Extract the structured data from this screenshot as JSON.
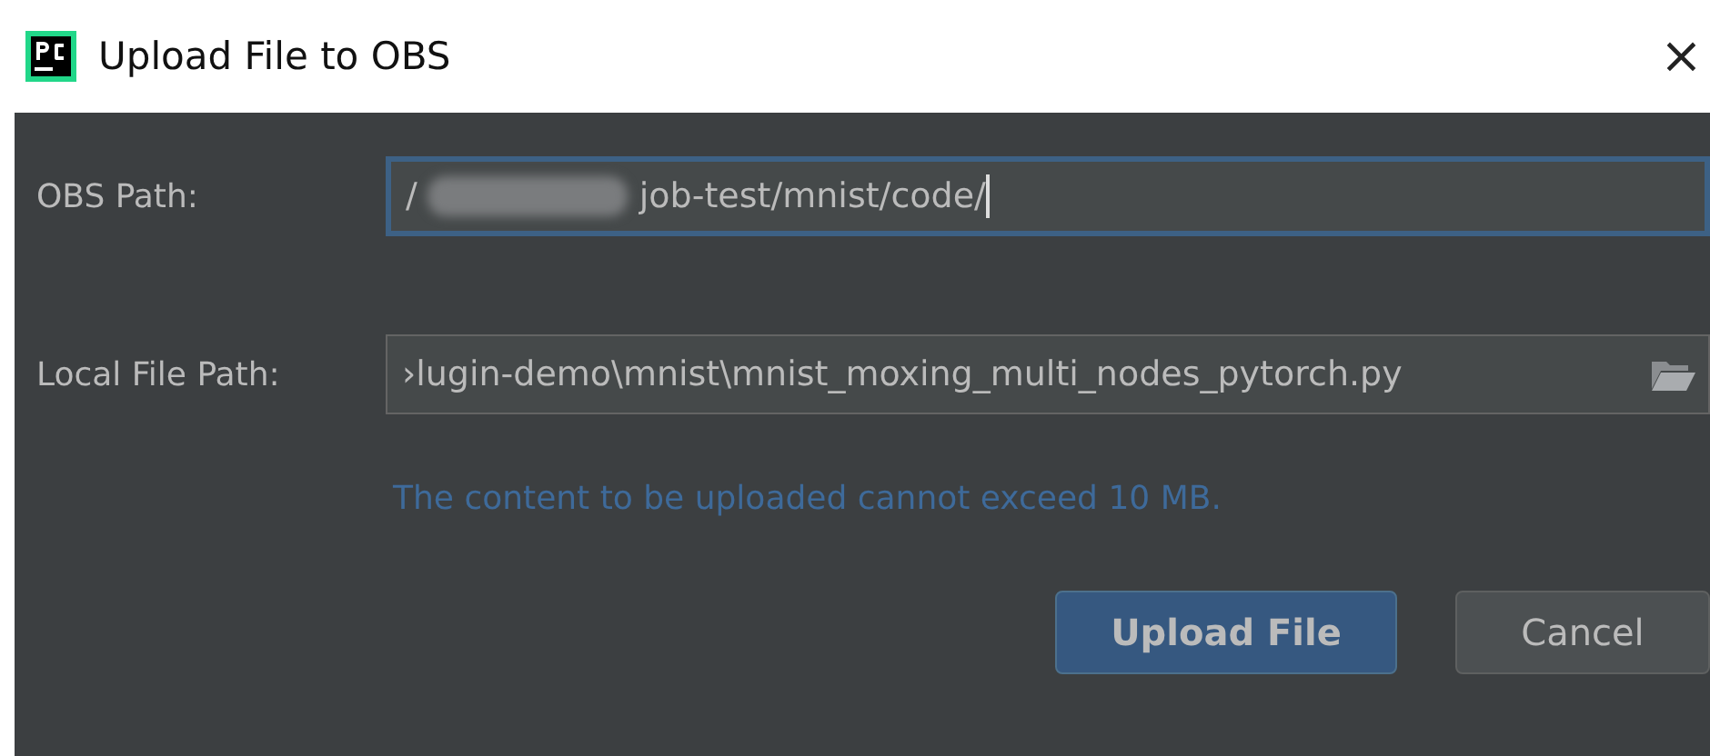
{
  "window": {
    "title": "Upload File to OBS",
    "close": "×"
  },
  "fields": [
    {
      "label": "OBS Path:",
      "prefix": "/",
      "redacted": true,
      "value": "job-test/mnist/code/",
      "focused": true,
      "browse": false
    },
    {
      "label": "Local File Path:",
      "redacted": false,
      "value": "›lugin-demo\\mnist\\mnist_moxing_multi_nodes_pytorch.py",
      "focused": false,
      "browse": true
    }
  ],
  "message": "The content to be uploaded cannot exceed 10 MB.",
  "buttons": [
    {
      "label": "Upload File",
      "kind": "primary"
    },
    {
      "label": "Cancel",
      "kind": "secondary"
    }
  ]
}
